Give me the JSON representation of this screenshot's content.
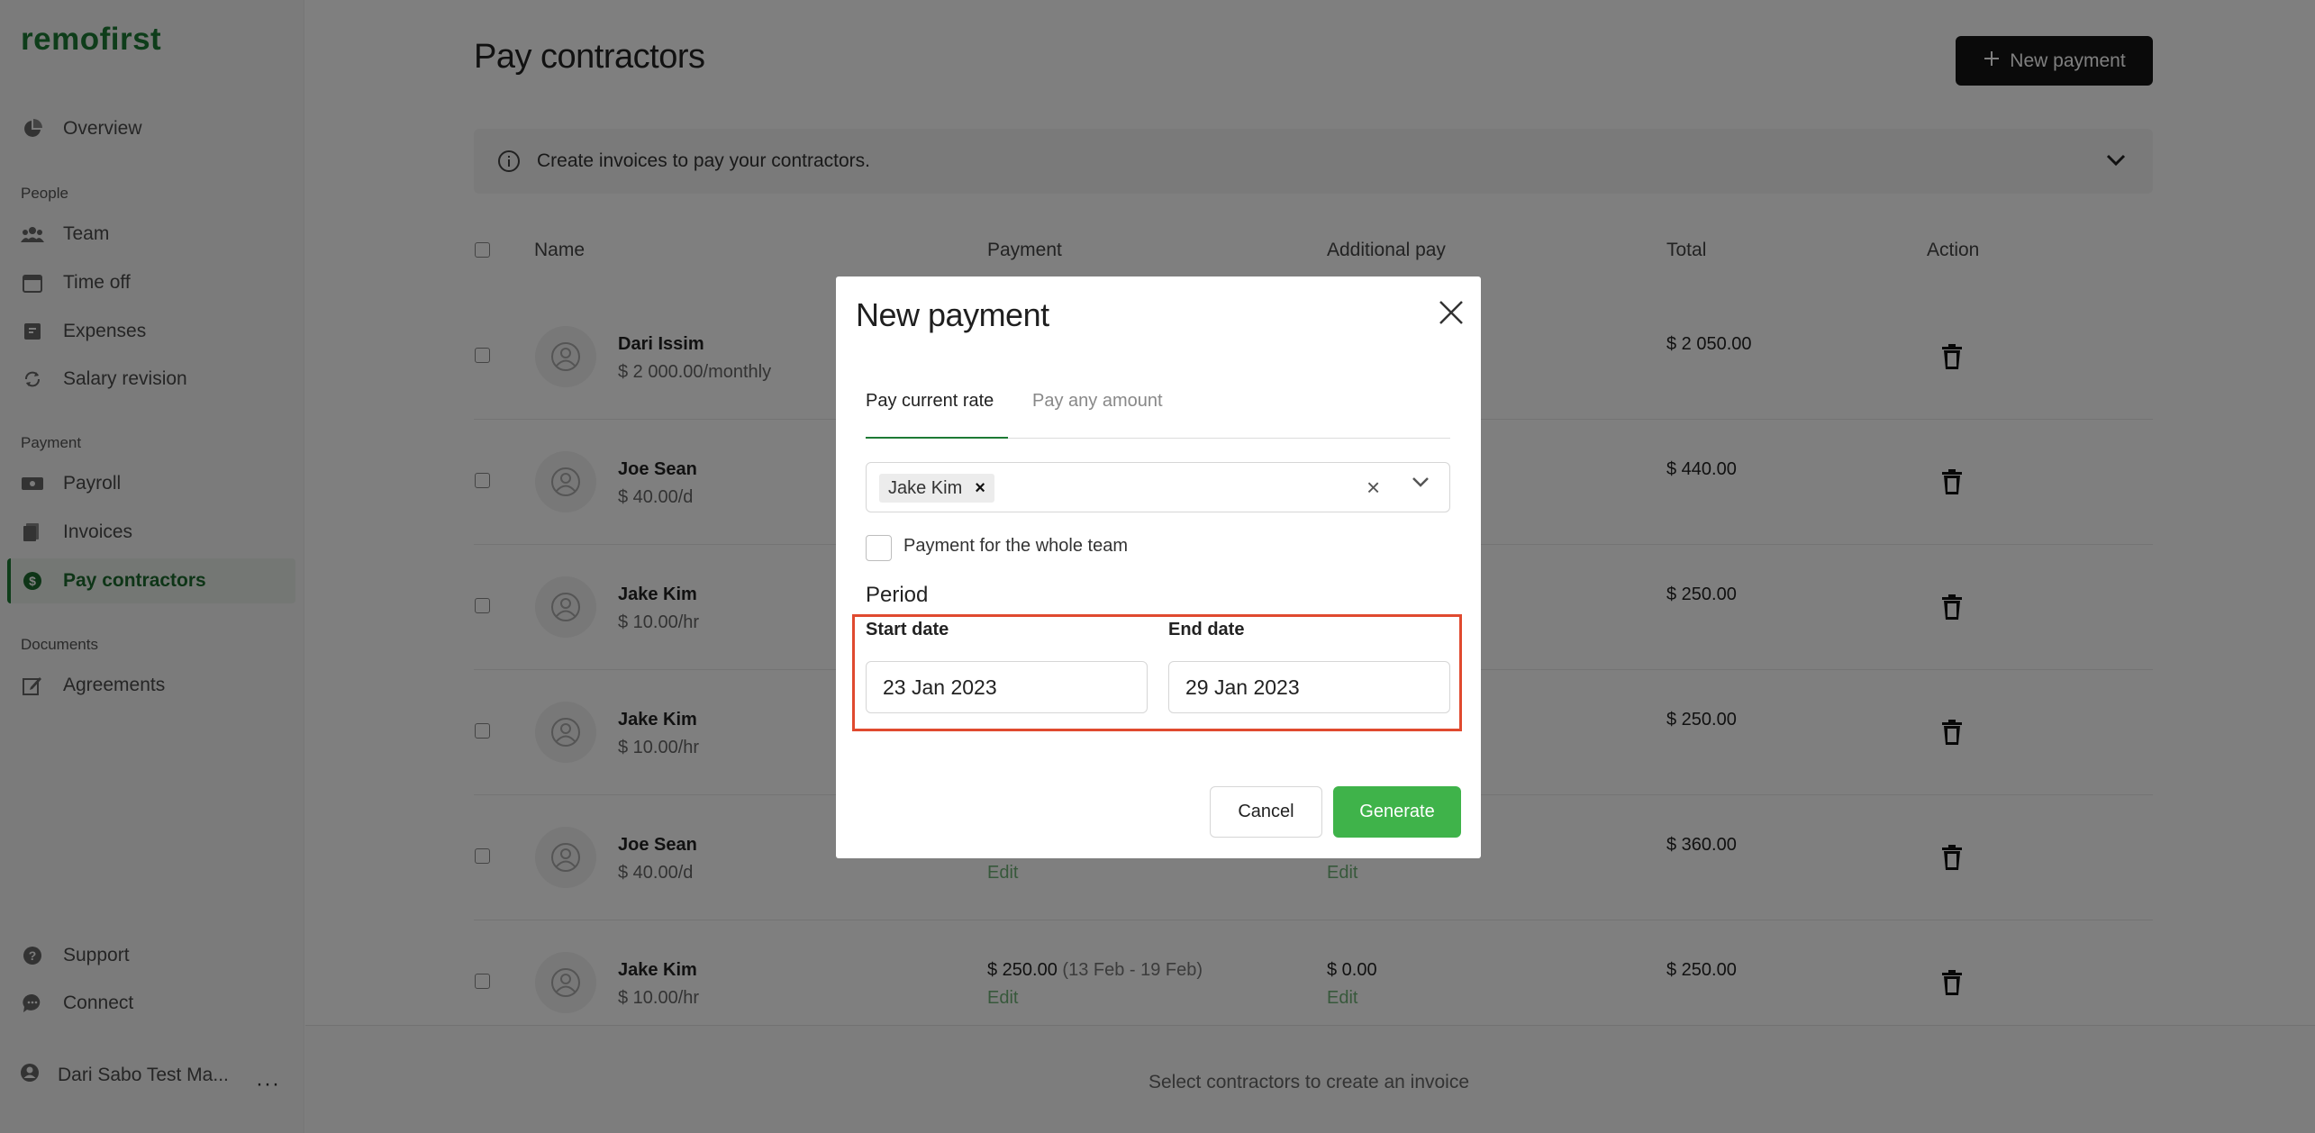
{
  "app": {
    "logo": "remofirst"
  },
  "sidebar": {
    "overview": "Overview",
    "sections": {
      "people": "People",
      "payment": "Payment",
      "documents": "Documents"
    },
    "items": {
      "team": "Team",
      "time_off": "Time off",
      "expenses": "Expenses",
      "salary_revision": "Salary revision",
      "payroll": "Payroll",
      "invoices": "Invoices",
      "pay_contractors": "Pay contractors",
      "agreements": "Agreements"
    },
    "support": "Support",
    "connect": "Connect",
    "user": "Dari Sabo Test Ma...",
    "more": "···"
  },
  "main": {
    "title": "Pay contractors",
    "new_payment_label": "New payment",
    "info_text": "Create invoices to pay your contractors.",
    "columns": {
      "name": "Name",
      "payment": "Payment",
      "additional_pay": "Additional pay",
      "total": "Total",
      "action": "Action"
    },
    "rows": [
      {
        "name": "Dari Issim",
        "rate": "$ 2 000.00/monthly",
        "payment": "",
        "range": "",
        "edit": "",
        "additional": "",
        "additional_edit": "",
        "total": "$ 2 050.00"
      },
      {
        "name": "Joe Sean",
        "rate": "$ 40.00/d",
        "payment": "",
        "range": "",
        "edit": "",
        "additional": "",
        "additional_edit": "",
        "total": "$ 440.00"
      },
      {
        "name": "Jake Kim",
        "rate": "$ 10.00/hr",
        "payment": "",
        "range": "",
        "edit": "",
        "additional": "",
        "additional_edit": "",
        "total": "$ 250.00"
      },
      {
        "name": "Jake Kim",
        "rate": "$ 10.00/hr",
        "payment": "",
        "range": "",
        "edit": "",
        "additional": "",
        "additional_edit": "",
        "total": "$ 250.00"
      },
      {
        "name": "Joe Sean",
        "rate": "$ 40.00/d",
        "payment": "",
        "range": "",
        "edit": "Edit",
        "additional": "",
        "additional_edit": "Edit",
        "total": "$ 360.00"
      },
      {
        "name": "Jake Kim",
        "rate": "$ 10.00/hr",
        "payment": "$ 250.00",
        "range": "(13 Feb - 19 Feb)",
        "edit": "Edit",
        "additional": "$ 0.00",
        "additional_edit": "Edit",
        "total": "$ 250.00"
      }
    ],
    "footer_text": "Select contractors to create an invoice"
  },
  "modal": {
    "title": "New payment",
    "tabs": {
      "current_rate": "Pay current rate",
      "any_amount": "Pay any amount"
    },
    "selected_contractor": "Jake Kim",
    "chip_remove": "×",
    "clear": "×",
    "whole_team_label": "Payment for the whole team",
    "period_label": "Period",
    "start_date_label": "Start date",
    "start_date_value": "23 Jan 2023",
    "end_date_label": "End date",
    "end_date_value": "29 Jan 2023",
    "cancel_label": "Cancel",
    "generate_label": "Generate"
  },
  "colors": {
    "brand": "#1d7a34",
    "generate": "#3fb34a",
    "highlight": "#e04a2f"
  }
}
